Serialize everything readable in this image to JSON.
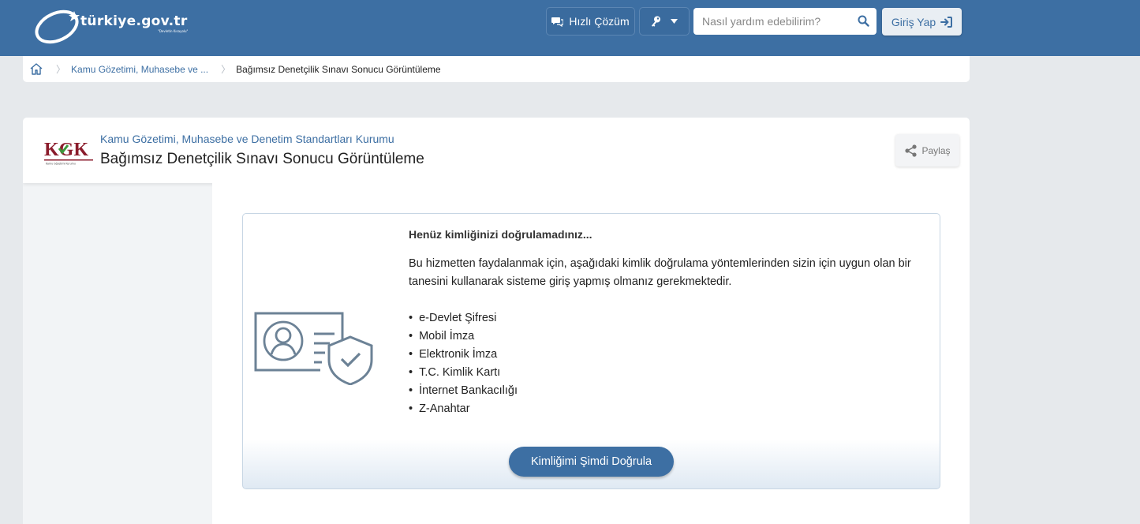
{
  "header": {
    "logo_text": "türkiye.gov.tr",
    "logo_sub": "\"Devletin Kısayolu\"",
    "quick_solution_label": "Hızlı Çözüm",
    "search_placeholder": "Nasıl yardım edebilirim?",
    "login_label": "Giriş Yap"
  },
  "breadcrumb": {
    "items": [
      "Kamu Gözetimi, Muhasebe ve ...",
      "Bağımsız Denetçilik Sınavı Sonucu Görüntüleme"
    ]
  },
  "service": {
    "institution_logo_text": "KGK",
    "institution_logo_sub": "Kamu Gözetimi Kurumu",
    "institution": "Kamu Gözetimi, Muhasebe ve Denetim Standartları Kurumu",
    "title": "Bağımsız Denetçilik Sınavı Sonucu Görüntüleme",
    "share_label": "Paylaş"
  },
  "auth": {
    "heading": "Henüz kimliğinizi doğrulamadınız...",
    "description": "Bu hizmetten faydalanmak için, aşağıdaki kimlik doğrulama yöntemlerinden sizin için uygun olan bir tanesini kullanarak sisteme giriş yapmış olmanız gerekmektedir.",
    "methods": [
      "e-Devlet Şifresi",
      "Mobil İmza",
      "Elektronik İmza",
      "T.C. Kimlik Kartı",
      "İnternet Bankacılığı",
      "Z-Anahtar"
    ],
    "verify_button": "Kimliğimi Şimdi Doğrula"
  },
  "colors": {
    "brand_blue": "#3d6fa3",
    "background": "#e6e9ec"
  }
}
